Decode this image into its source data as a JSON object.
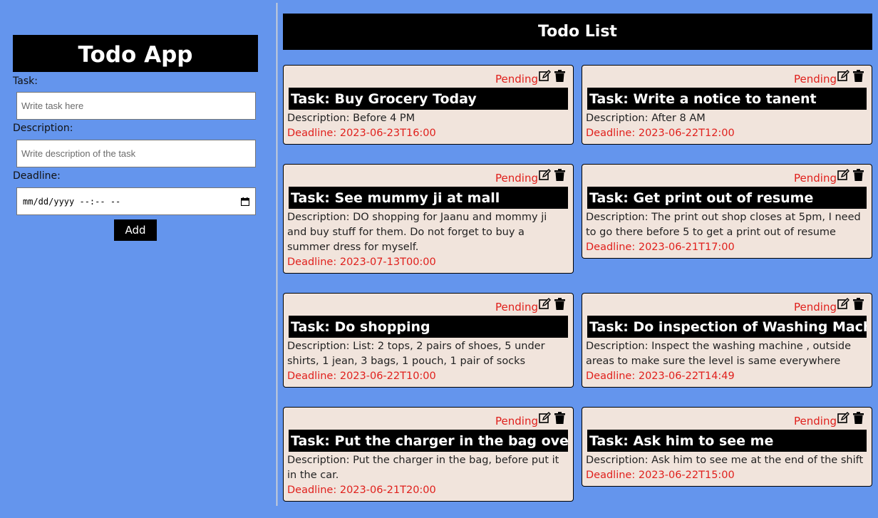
{
  "form": {
    "title": "Todo App",
    "task_label": "Task:",
    "task_placeholder": "Write task here",
    "description_label": "Description:",
    "description_placeholder": "Write description of the task",
    "deadline_label": "Deadline:",
    "deadline_placeholder": "mm/dd/yyyy --:-- --",
    "add_label": "Add"
  },
  "list": {
    "title": "Todo List",
    "tasks": [
      {
        "title": "Task: Buy Grocery Today",
        "status": "Pending",
        "description": "Description: Before 4 PM",
        "deadline": "Deadline: 2023-06-23T16:00"
      },
      {
        "title": "Task: Write a notice to tanent",
        "status": "Pending",
        "description": "Description: After 8 AM",
        "deadline": "Deadline: 2023-06-22T12:00"
      },
      {
        "title": "Task: See mummy ji at mall",
        "status": "Pending",
        "description": "Description: DO shopping for Jaanu and mommy ji and buy stuff for them. Do not forget to buy a summer dress for myself.",
        "deadline": "Deadline: 2023-07-13T00:00"
      },
      {
        "title": "Task: Get print out of resume",
        "status": "Pending",
        "description": "Description: The print out shop closes at 5pm, I need to go there before 5 to get a print out of resume",
        "deadline": "Deadline: 2023-06-21T17:00"
      },
      {
        "title": "Task: Do shopping",
        "status": "Pending",
        "description": "Description: List: 2 tops, 2 pairs of shoes, 5 under shirts, 1 jean, 3 bags, 1 pouch, 1 pair of socks",
        "deadline": "Deadline: 2023-06-22T10:00"
      },
      {
        "title": "Task: Do inspection of Washing Machine",
        "status": "Pending",
        "description": "Description: Inspect the washing machine , outside areas to make sure the level is same everywhere",
        "deadline": "Deadline: 2023-06-22T14:49"
      },
      {
        "title": "Task: Put the charger in the bag overnight",
        "status": "Pending",
        "description": "Description: Put the charger in the bag, before put it in the car.",
        "deadline": "Deadline: 2023-06-21T20:00"
      },
      {
        "title": "Task: Ask him to see me",
        "status": "Pending",
        "description": "Description: Ask him to see me at the end of the shift",
        "deadline": "Deadline: 2023-06-22T15:00"
      }
    ]
  },
  "colors": {
    "background": "#6495ed",
    "card": "#f1e4dc",
    "status": "#e0201c"
  },
  "icons": {
    "edit": "edit-icon",
    "delete": "trash-icon",
    "calendar": "calendar-icon"
  }
}
